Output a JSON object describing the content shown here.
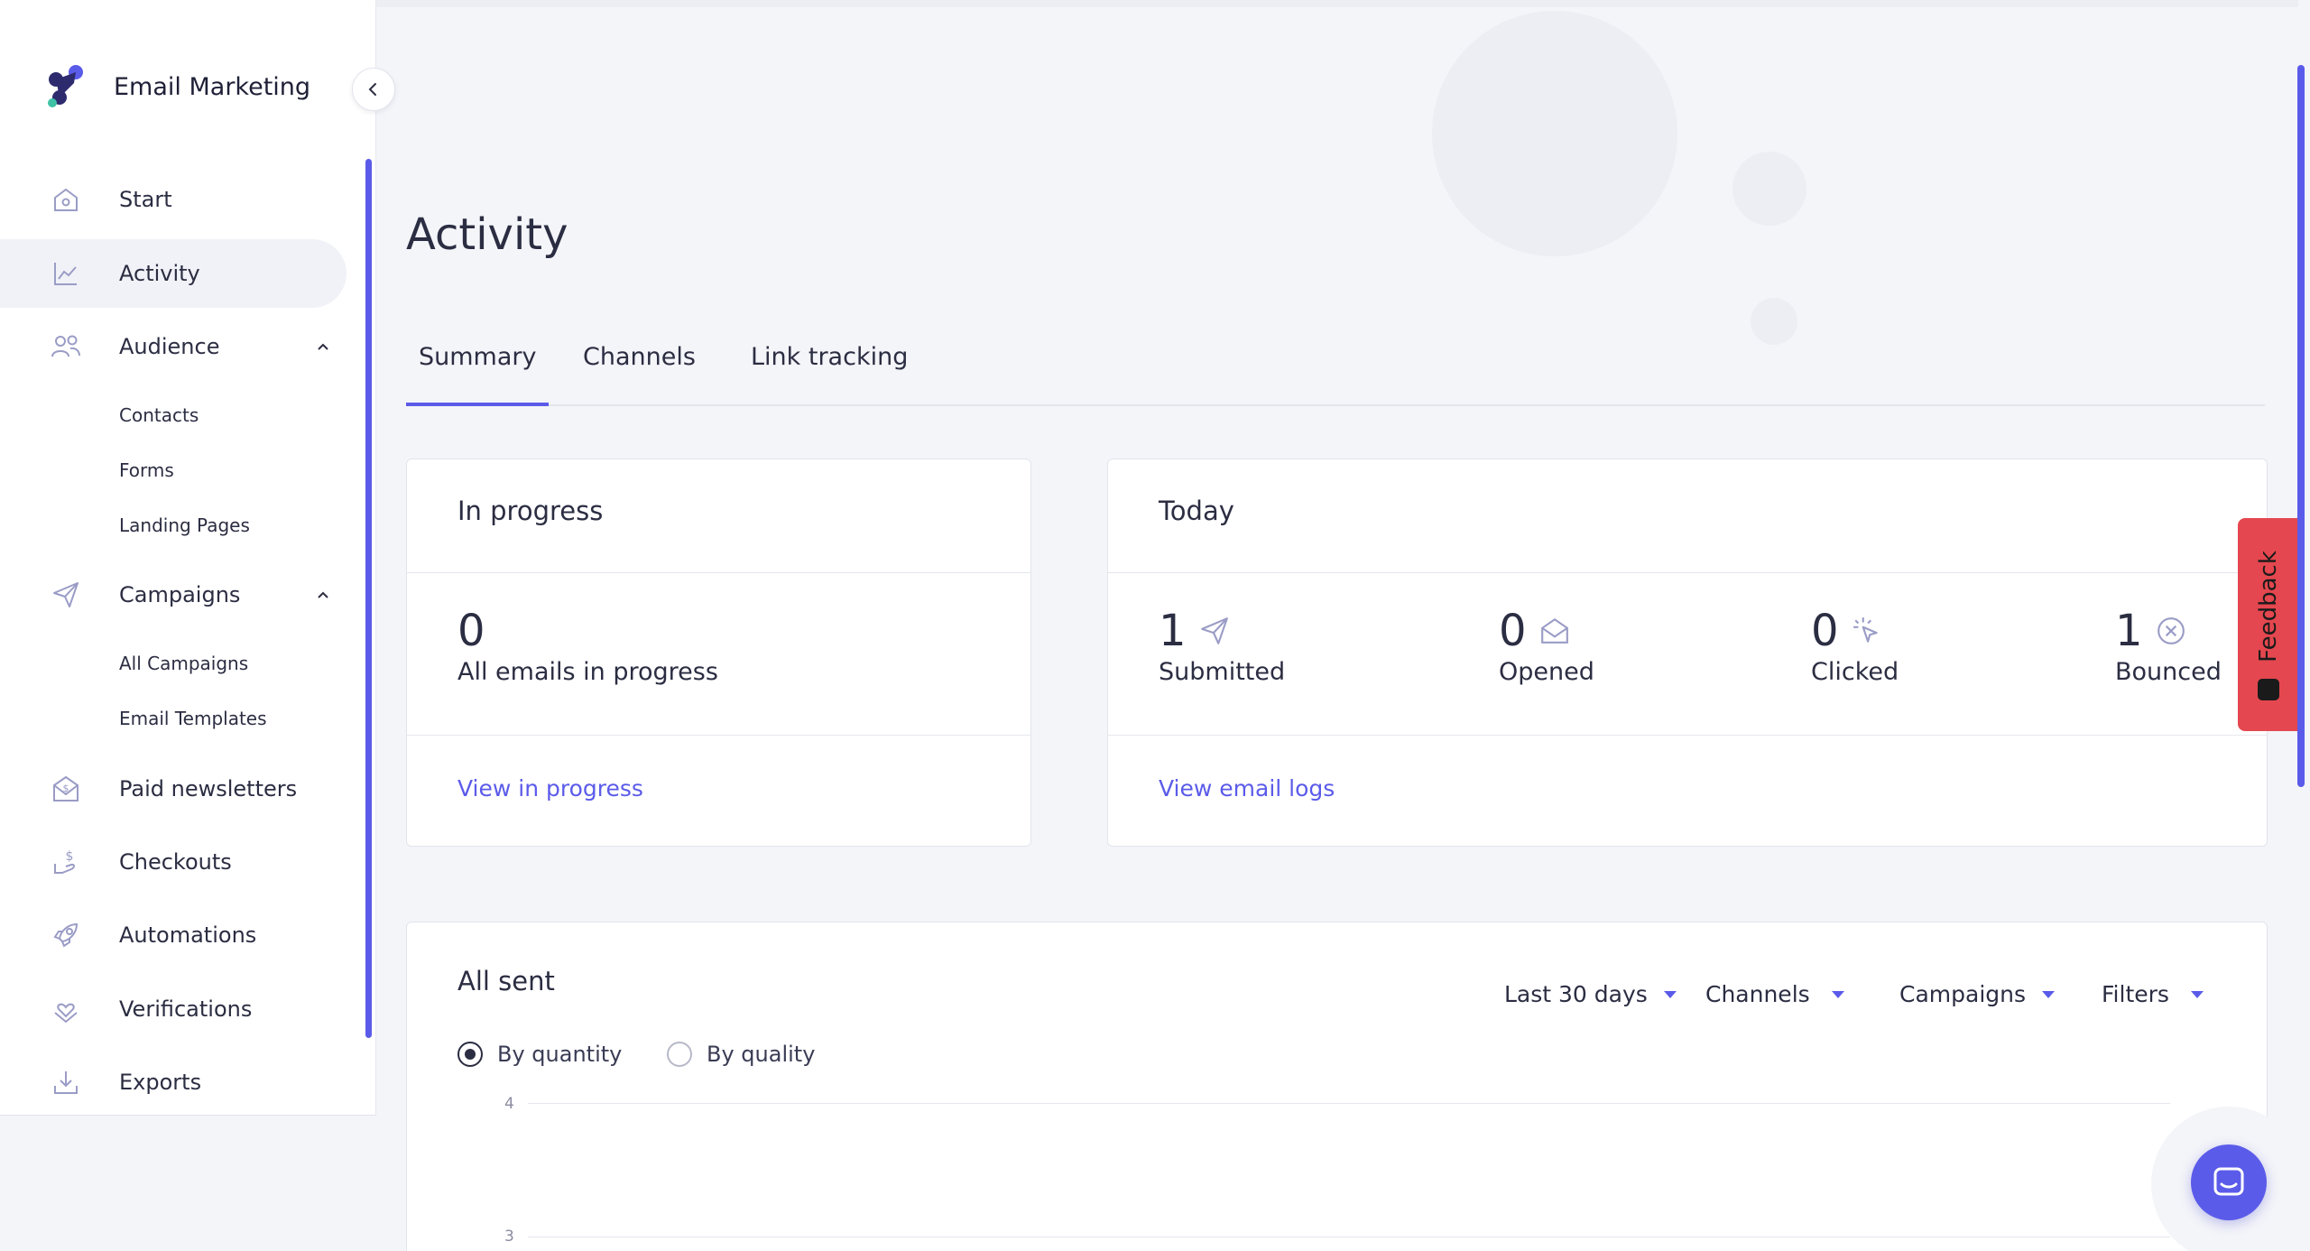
{
  "brand": {
    "name": "Email Marketing"
  },
  "sidebar": {
    "items": [
      {
        "label": "Start",
        "icon": "home-icon"
      },
      {
        "label": "Activity",
        "icon": "chart-icon",
        "active": true
      },
      {
        "label": "Audience",
        "icon": "users-icon",
        "expanded": true,
        "children": [
          "Contacts",
          "Forms",
          "Landing Pages"
        ]
      },
      {
        "label": "Campaigns",
        "icon": "paper-plane-icon",
        "expanded": true,
        "children": [
          "All Campaigns",
          "Email Templates"
        ]
      },
      {
        "label": "Paid newsletters",
        "icon": "money-envelope-icon"
      },
      {
        "label": "Checkouts",
        "icon": "hand-dollar-icon"
      },
      {
        "label": "Automations",
        "icon": "rocket-icon"
      },
      {
        "label": "Verifications",
        "icon": "heart-hand-icon"
      },
      {
        "label": "Exports",
        "icon": "download-icon"
      }
    ]
  },
  "page": {
    "title": "Activity"
  },
  "tabs": [
    {
      "label": "Summary",
      "active": true
    },
    {
      "label": "Channels",
      "active": false
    },
    {
      "label": "Link tracking",
      "active": false
    }
  ],
  "in_progress": {
    "title": "In progress",
    "value": "0",
    "label": "All emails in progress",
    "link": "View in progress"
  },
  "today": {
    "title": "Today",
    "metrics": [
      {
        "value": "1",
        "label": "Submitted",
        "icon": "paper-plane-icon"
      },
      {
        "value": "0",
        "label": "Opened",
        "icon": "open-envelope-icon"
      },
      {
        "value": "0",
        "label": "Clicked",
        "icon": "click-icon"
      },
      {
        "value": "1",
        "label": "Bounced",
        "icon": "circle-x-icon"
      }
    ],
    "link": "View email logs"
  },
  "all_sent": {
    "title": "All sent",
    "filters": [
      "Last 30 days",
      "Channels",
      "Campaigns",
      "Filters"
    ],
    "modes": [
      {
        "label": "By quantity",
        "checked": true
      },
      {
        "label": "By quality",
        "checked": false
      }
    ],
    "y_ticks": [
      "4",
      "3"
    ]
  },
  "feedback": {
    "label": "Feedback"
  },
  "colors": {
    "accent": "#5b5bea",
    "feedback": "#e4474f",
    "text": "#2b2d42"
  }
}
